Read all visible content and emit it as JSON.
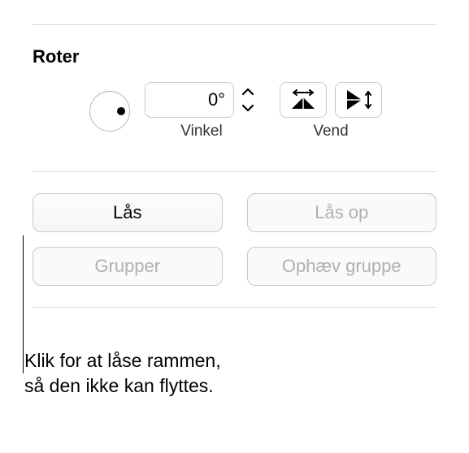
{
  "rotate": {
    "title": "Roter",
    "angle_value": "0°",
    "angle_label": "Vinkel",
    "flip_label": "Vend"
  },
  "buttons": {
    "lock": "Lås",
    "unlock": "Lås op",
    "group": "Grupper",
    "ungroup": "Ophæv gruppe"
  },
  "callout": {
    "line1": "Klik for at låse rammen,",
    "line2": "så den ikke kan flyttes."
  }
}
